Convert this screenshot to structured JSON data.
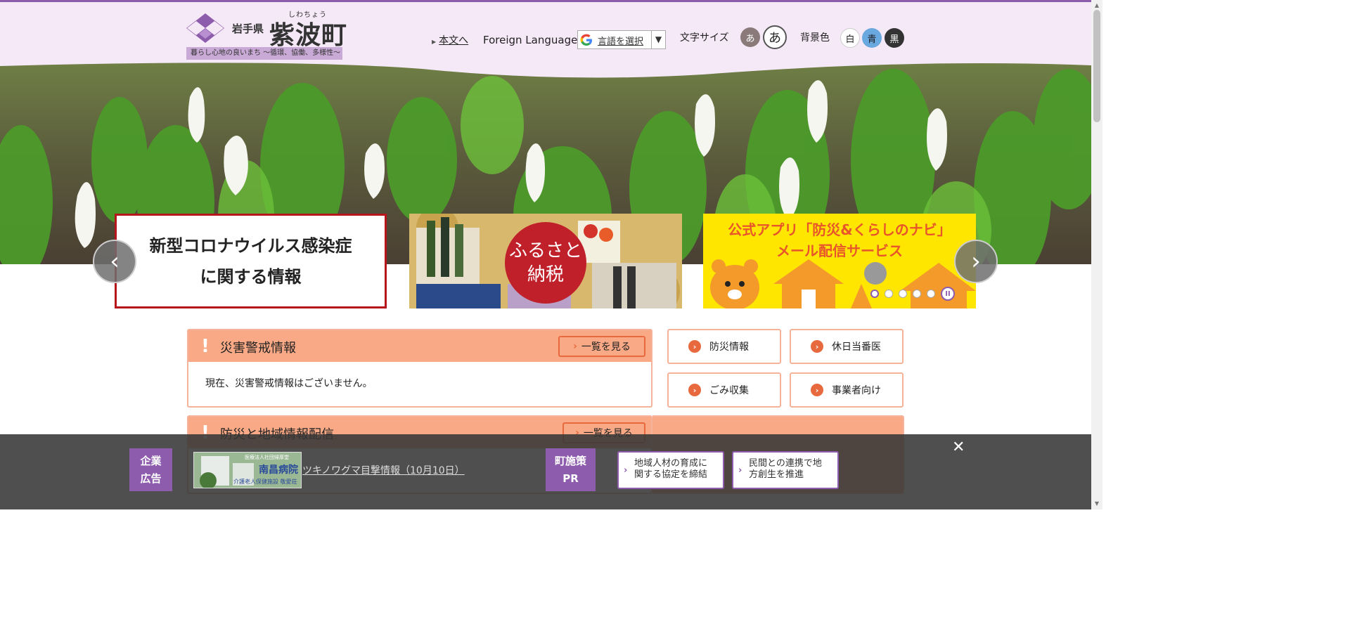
{
  "header": {
    "prefecture": "岩手県",
    "town_furigana": "しわちょう",
    "town_name": "紫波町",
    "tagline": "暮らし心地の良いまち ～循環、協働、多様性～",
    "skip_link": "本文へ",
    "foreign_language": "Foreign Language",
    "language_select": "言語を選択",
    "language_arrow": "▼",
    "text_size_label": "文字サイズ",
    "text_size_small": "あ",
    "text_size_large": "あ",
    "bg_color_label": "背景色",
    "bg_white": "白",
    "bg_blue": "青",
    "bg_black": "黒"
  },
  "carousel": {
    "prev": "‹",
    "next": "›",
    "banner1_line1": "新型コロナウイルス感染症",
    "banner1_line2": "に関する情報",
    "banner2_line1": "ふるさと",
    "banner2_line2": "納税",
    "banner3_line1": "公式アプリ「防災&くらしのナビ」",
    "banner3_line2": "メール配信サービス",
    "pause": "II"
  },
  "alerts": {
    "disaster_title": "災害警戒情報",
    "disaster_more": "一覧を見る",
    "disaster_body": "現在、災害警戒情報はございません。",
    "regional_title": "防災と地域情報配信",
    "regional_more": "一覧を見る"
  },
  "quick_links": [
    {
      "label": "防災情報"
    },
    {
      "label": "休日当番医"
    },
    {
      "label": "ごみ収集"
    },
    {
      "label": "事業者向け"
    }
  ],
  "bottom_bar": {
    "ad_tag_line1": "企業",
    "ad_tag_line2": "広告",
    "ad_image_line1": "医療法人社団帰厚堂",
    "ad_image_line2": "南昌病院",
    "ad_image_line3": "介護老人保健施設 敬愛荘",
    "ad_link": "ツキノワグマ目撃情報（10月10日）",
    "pr_tag_line1": "町施策",
    "pr_tag_line2": "PR",
    "pr1_line1": "地域人材の育成に",
    "pr1_line2": "関する協定を締結",
    "pr2_line1": "民間との連携で地",
    "pr2_line2": "方創生を推進",
    "close": "✕"
  },
  "colors": {
    "brand_purple": "#8e5cad",
    "alert_salmon": "#f9a986",
    "alert_orange": "#e8693e",
    "covid_red": "#b5151b",
    "app_yellow": "#ffe600"
  }
}
